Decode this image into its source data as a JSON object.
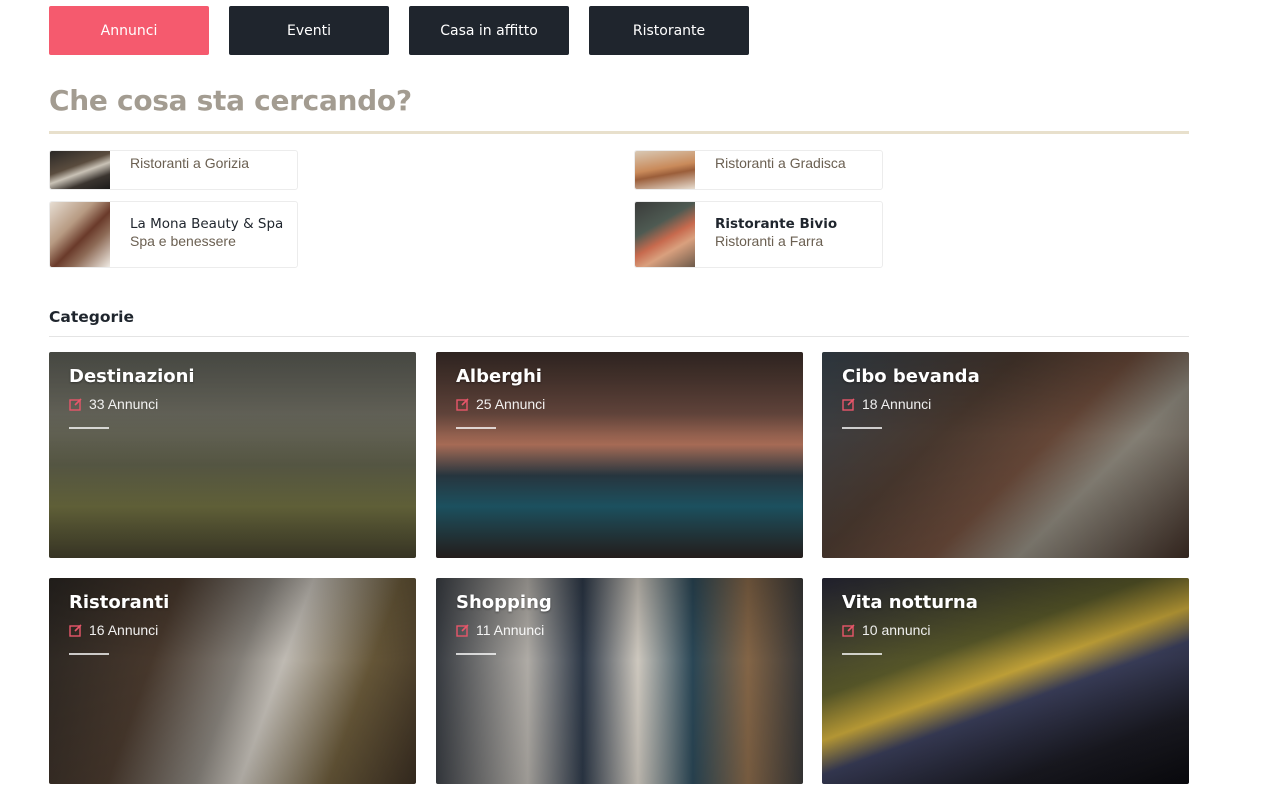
{
  "tabs": [
    {
      "label": "Annunci",
      "active": true
    },
    {
      "label": "Eventi",
      "active": false
    },
    {
      "label": "Casa in affitto",
      "active": false
    },
    {
      "label": "Ristorante",
      "active": false
    }
  ],
  "search": {
    "title": "Che cosa sta cercando?"
  },
  "results": [
    {
      "name": "",
      "subtitle": "Ristoranti a Gorizia"
    },
    {
      "name": "",
      "subtitle": "Ristoranti a Gradisca"
    },
    {
      "name": "La Mona Beauty & Spa",
      "subtitle": "Spa e benessere"
    },
    {
      "name": "Ristorante Bivio",
      "subtitle": "Ristoranti a Farra"
    }
  ],
  "categories": {
    "heading": "Categorie",
    "items": [
      {
        "title": "Destinazioni",
        "count": "33 Annunci"
      },
      {
        "title": "Alberghi",
        "count": "25 Annunci"
      },
      {
        "title": "Cibo bevanda",
        "count": "18 Annunci"
      },
      {
        "title": "Ristoranti",
        "count": "16 Annunci"
      },
      {
        "title": "Shopping",
        "count": "11 Annunci"
      },
      {
        "title": "Vita notturna",
        "count": "10 annunci"
      }
    ]
  },
  "colors": {
    "accent": "#f55a6e",
    "dark_button": "#1f252d",
    "heading_muted": "#a39c91",
    "icon_pink": "#e8566a"
  }
}
